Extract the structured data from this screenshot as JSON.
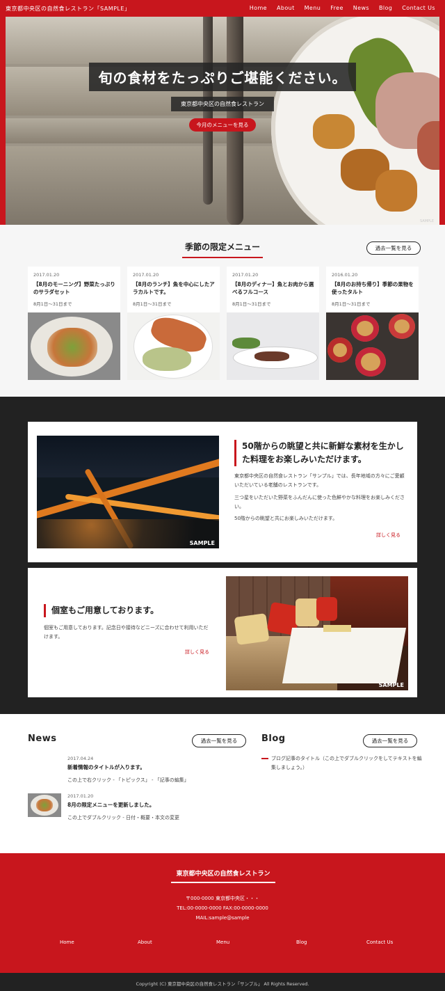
{
  "header": {
    "logo": "東京都中央区の自然食レストラン「SAMPLE」",
    "nav": [
      "Home",
      "About",
      "Menu",
      "Free",
      "News",
      "Blog",
      "Contact Us"
    ]
  },
  "hero": {
    "title": "旬の食材をたっぷりご堪能ください。",
    "subtitle": "東京都中央区の自然食レストラン",
    "button": "今月のメニューを見る",
    "watermark": "SAMPLE"
  },
  "season": {
    "title": "季節の限定メニュー",
    "list_button": "過去一覧を見る",
    "cards": [
      {
        "date": "2017.01.20",
        "title": "【8月のモーニング】野菜たっぷりのサラダセット",
        "period": "8月1日～31日まで"
      },
      {
        "date": "2017.01.20",
        "title": "【8月のランチ】魚を中心にしたアラカルトです。",
        "period": "8月1日～31日まで"
      },
      {
        "date": "2017.01.20",
        "title": "【8月のディナー】魚とお肉から選べるフルコース",
        "period": "8月1日～31日まで"
      },
      {
        "date": "2016.01.20",
        "title": "【8月のお持ち帰り】季節の果物を使ったタルト",
        "period": "8月1日～31日まで"
      }
    ]
  },
  "features": [
    {
      "heading": "50階からの眺望と共に新鮮な素材を生かした料理をお楽しみいただけます。",
      "paragraphs": [
        "東京都中央区の自然食レストラン「サンプル」では、長年地域の方々にご愛顧いただいている老舗のレストランです。",
        "三つ星をいただいた野菜をふんだんに使った色鮮やかな料理をお楽しみください。",
        "50階からの眺望と共にお楽しみいただけます。"
      ],
      "more": "詳しく見る",
      "image_label": "SAMPLE"
    },
    {
      "heading": "個室もご用意しております。",
      "paragraphs": [
        "個室もご用意しております。記念日や接待などニーズに合わせて利用いただけます。"
      ],
      "more": "詳しく見る",
      "image_label": "SAMPLE"
    }
  ],
  "news": {
    "title": "News",
    "list_button": "過去一覧を見る",
    "items": [
      {
        "date": "2017.04.24",
        "title": "新着情報のタイトルが入ります。",
        "sub": "この上で右クリック - 「トピックス」 - 「記事の編集」"
      },
      {
        "date": "2017.01.20",
        "title": "8月の限定メニューを更新しました。",
        "sub": "この上でダブルクリック - 日付・概要・本文の変更"
      }
    ]
  },
  "blog": {
    "title": "Blog",
    "list_button": "過去一覧を見る",
    "text": "ブログ記事のタイトル（この上でダブルクリックをしてテキストを編集しましょう。）"
  },
  "footer": {
    "title": "東京都中央区の自然食レストラン",
    "address": [
      "〒000-0000 東京都中央区・・・",
      "TEL:00-0000-0000 FAX:00-0000-0000",
      "MAIL:sample@sample"
    ],
    "nav": [
      "Home",
      "About",
      "Menu",
      "Blog",
      "Contact Us"
    ],
    "copyright": "Copyright (C) 東京都中央区の自然食レストラン「サンプル」 All Rights Reserved."
  },
  "colors": {
    "accent": "#c8161d",
    "dark": "#222222",
    "light_bg": "#f6f6f6"
  }
}
